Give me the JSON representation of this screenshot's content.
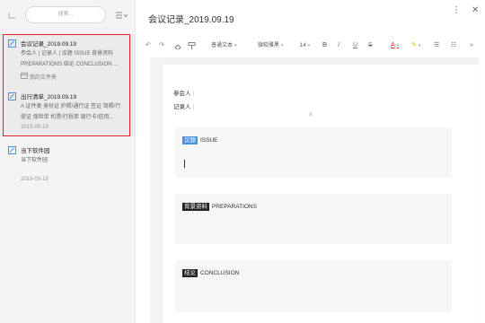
{
  "sidebar": {
    "search_placeholder": "搜索...",
    "notes": [
      {
        "title": "会议记录_2019.09.19",
        "snippet": "参会人 | 记录人 | 议题 ISSUE 背景资料 PREPARATIONS 结论 CONCLUSION ...",
        "folder": "我的文件夹"
      },
      {
        "title": "出行清单_2019.09.19",
        "snippet": "A 证件类 身份证 护照/通行证 签证 驾照/行驶证 保险单 机票/行程单 银行卡/信用...",
        "date": "2019-09-19"
      },
      {
        "title": "当下软件园",
        "snippet": "当下软件园",
        "date": "2019-09-19"
      }
    ]
  },
  "main": {
    "title": "会议记录_2019.09.19",
    "toolbar": {
      "paragraph": "普通文本",
      "font": "微软雅黑",
      "size": "14",
      "bold": "B",
      "italic": "I",
      "underline": "U",
      "strike": "S",
      "font_color": "A",
      "more": "»"
    },
    "doc": {
      "attendees_label": "参会人",
      "recorder_label": "记录人",
      "sections": [
        {
          "tag": "议题",
          "title": "ISSUE",
          "tag_color": "#4a90e2"
        },
        {
          "tag": "背景资料",
          "title": "PREPARATIONS",
          "tag_color": "#222222"
        },
        {
          "tag": "结论",
          "title": "CONCLUSION",
          "tag_color": "#222222"
        }
      ]
    }
  },
  "colors": {
    "accent_blue": "#4a90e2",
    "highlight_red": "#e52222",
    "sidebar_bg": "#f4f4f4"
  }
}
